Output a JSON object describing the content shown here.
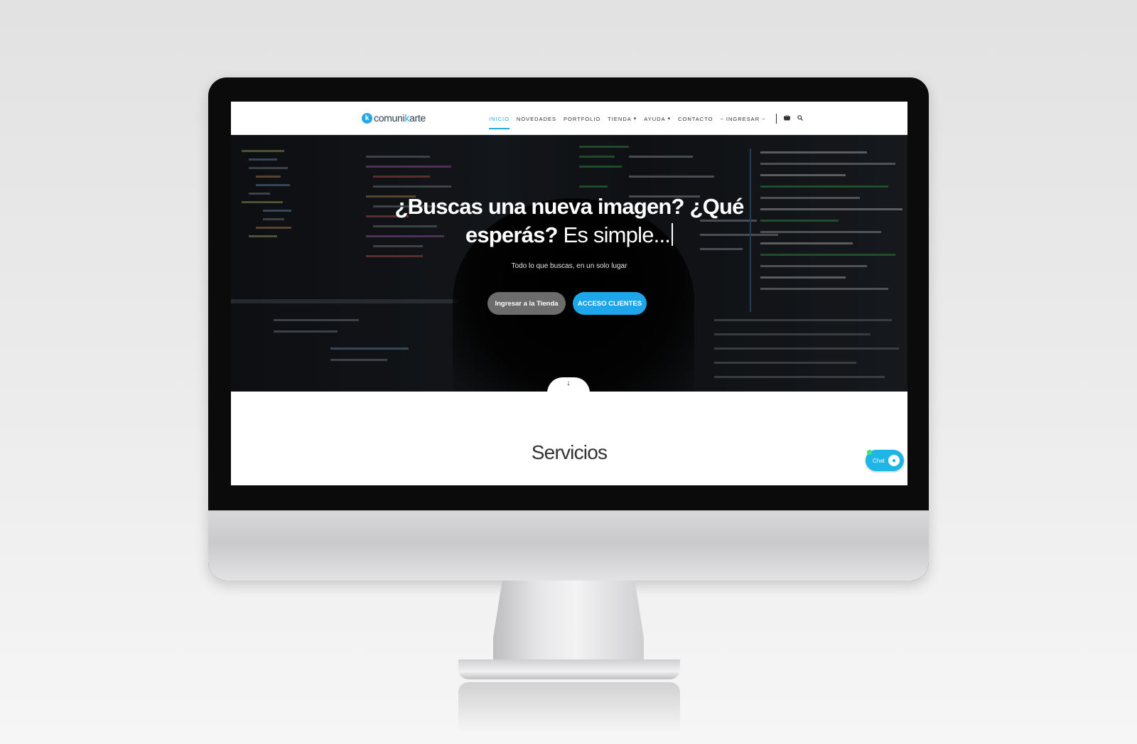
{
  "logo": {
    "mark": "k",
    "text_a": "comuni",
    "text_k": "k",
    "text_b": "arte"
  },
  "nav": {
    "items": [
      {
        "label": "INICIO"
      },
      {
        "label": "NOVEDADES"
      },
      {
        "label": "PORTFOLIO"
      },
      {
        "label": "TIENDA"
      },
      {
        "label": "AYUDA"
      },
      {
        "label": "CONTACTO"
      },
      {
        "label": "~ INGRESAR ~"
      }
    ],
    "cart_icon": "basket-icon",
    "search_icon": "search-icon"
  },
  "hero": {
    "title_line1": "¿Buscas una nueva imagen? ¿Qué",
    "title_bold2": "esperás?",
    "title_light2": "Es simple...",
    "subtitle": "Todo lo que buscas, en un solo lugar",
    "btn_store": "Ingresar a la Tienda",
    "btn_clients": "ACCESO CLIENTES",
    "scroll_icon": "arrow-down-icon"
  },
  "content": {
    "services_title": "Servicios"
  },
  "chat": {
    "label": "Chat",
    "icon": "chat-bubble-icon"
  },
  "colors": {
    "accent": "#25a7e2",
    "button_gray": "#6c6c6c",
    "chat": "#1fb6e6"
  }
}
